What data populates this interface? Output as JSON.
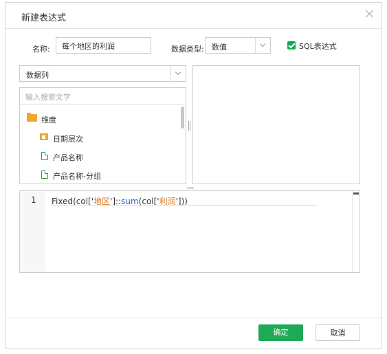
{
  "dialog": {
    "title": "新建表达式",
    "name_label": "名称:",
    "name_value": "每个地区的利润",
    "type_label": "数据类型:",
    "type_value": "数值",
    "sql_label": "SQL表达式",
    "column_select": "数据列",
    "search_placeholder": "输入搜索文字",
    "tree": [
      {
        "label": "维度",
        "icon": "folder-icon"
      },
      {
        "label": "日期层次",
        "icon": "date-folder-icon"
      },
      {
        "label": "产品名称",
        "icon": "doc-icon"
      },
      {
        "label": "产品名称-分组",
        "icon": "doc-icon"
      }
    ],
    "editor": {
      "line_number": "1",
      "code": {
        "p1": "Fixed(col['",
        "s1": "地区",
        "p2": "']::",
        "f1": "sum",
        "p3": "(col['",
        "s2": "利润",
        "p4": "']))"
      }
    },
    "ok_label": "确定",
    "cancel_label": "取消"
  },
  "colors": {
    "accent": "#1fa855",
    "string": "#e07a1a",
    "function": "#2b66c8"
  }
}
